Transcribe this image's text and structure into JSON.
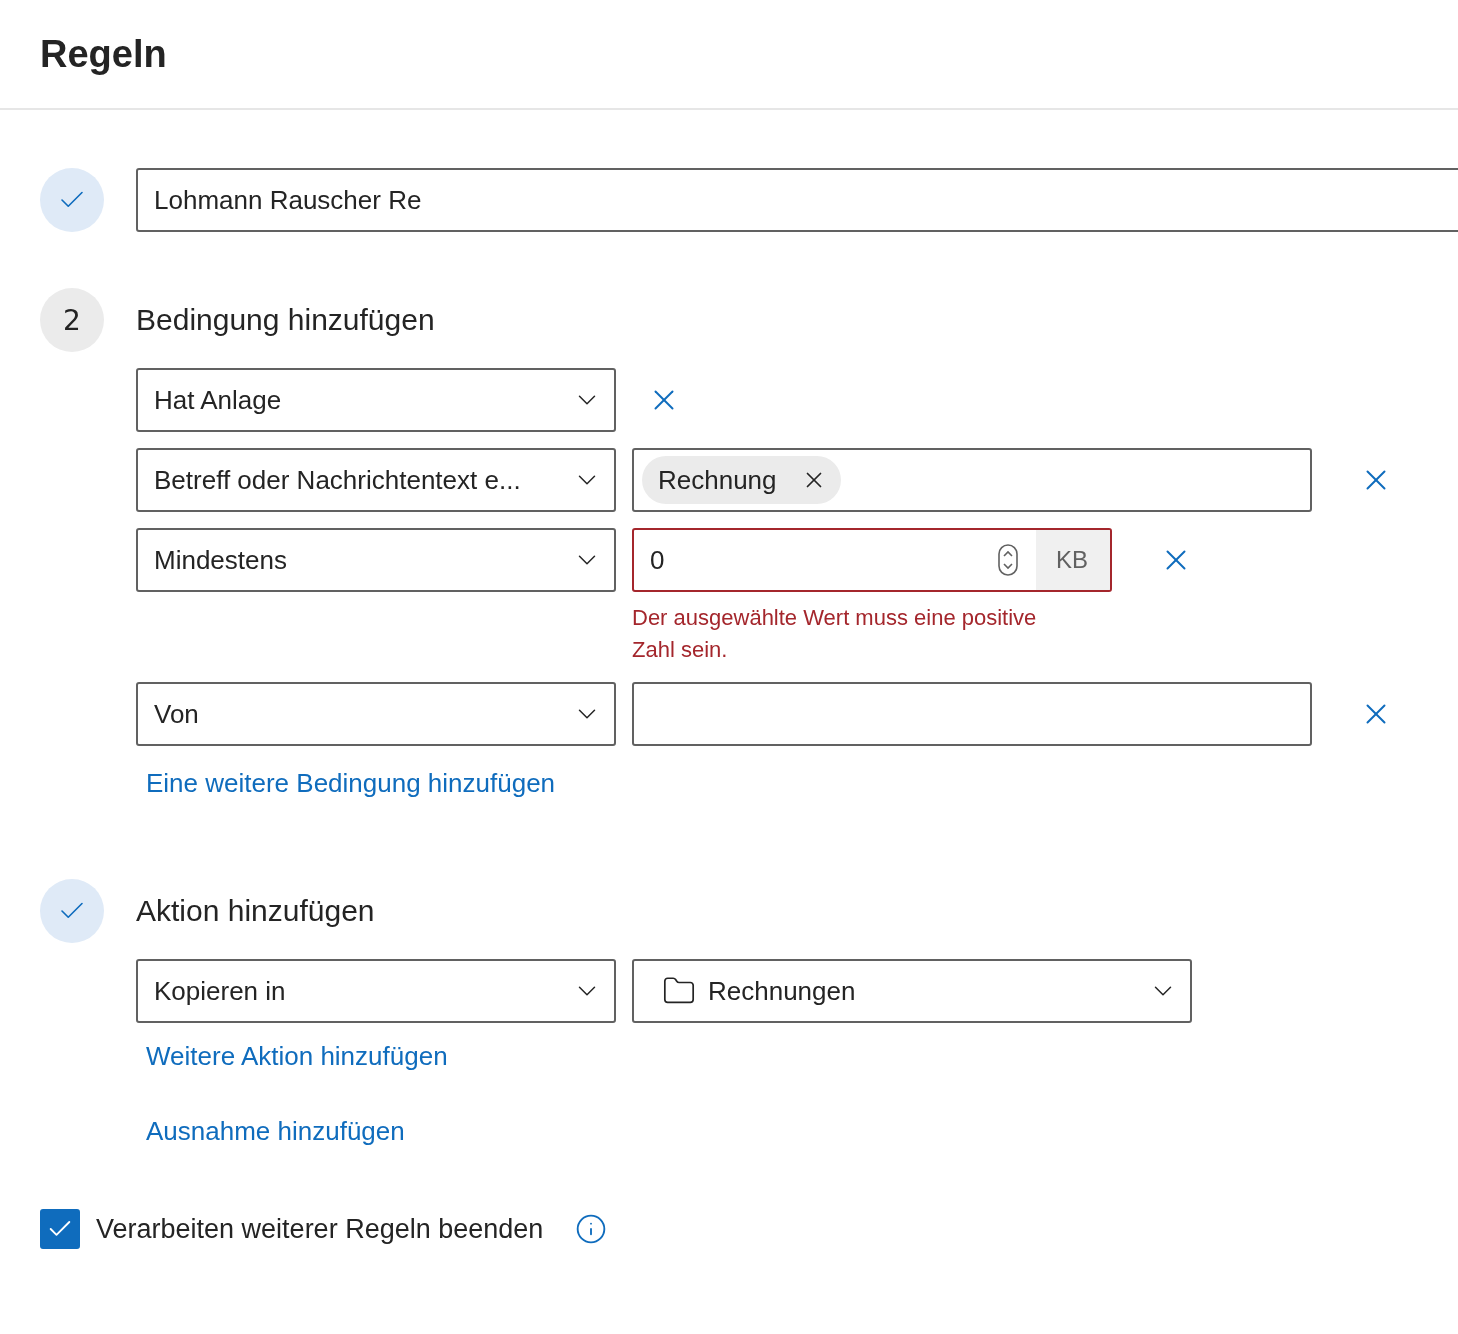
{
  "title": "Regeln",
  "rule_name": {
    "done": true,
    "value": "Lohmann Rauscher Re"
  },
  "conditions": {
    "done": false,
    "number": "2",
    "heading": "Bedingung hinzufügen",
    "rows": [
      {
        "kind": "single",
        "selector": "Hat Anlage"
      },
      {
        "kind": "tags",
        "selector": "Betreff oder Nachrichtentext e...",
        "tags": [
          "Rechnung"
        ]
      },
      {
        "kind": "number",
        "selector": "Mindestens",
        "value": "0",
        "unit": "KB",
        "invalid": true,
        "error": "Der ausgewählte Wert muss eine positive Zahl sein."
      },
      {
        "kind": "text",
        "selector": "Von"
      }
    ],
    "add_link": "Eine weitere Bedingung hinzufügen"
  },
  "actions": {
    "done": true,
    "heading": "Aktion hinzufügen",
    "rows": [
      {
        "kind": "folder",
        "selector": "Kopieren in",
        "folder": "Rechnungen"
      }
    ],
    "links": [
      "Weitere Aktion hinzufügen",
      "Ausnahme hinzufügen"
    ]
  },
  "stop_processing": {
    "checked": true,
    "label": "Verarbeiten weiterer Regeln beenden"
  }
}
